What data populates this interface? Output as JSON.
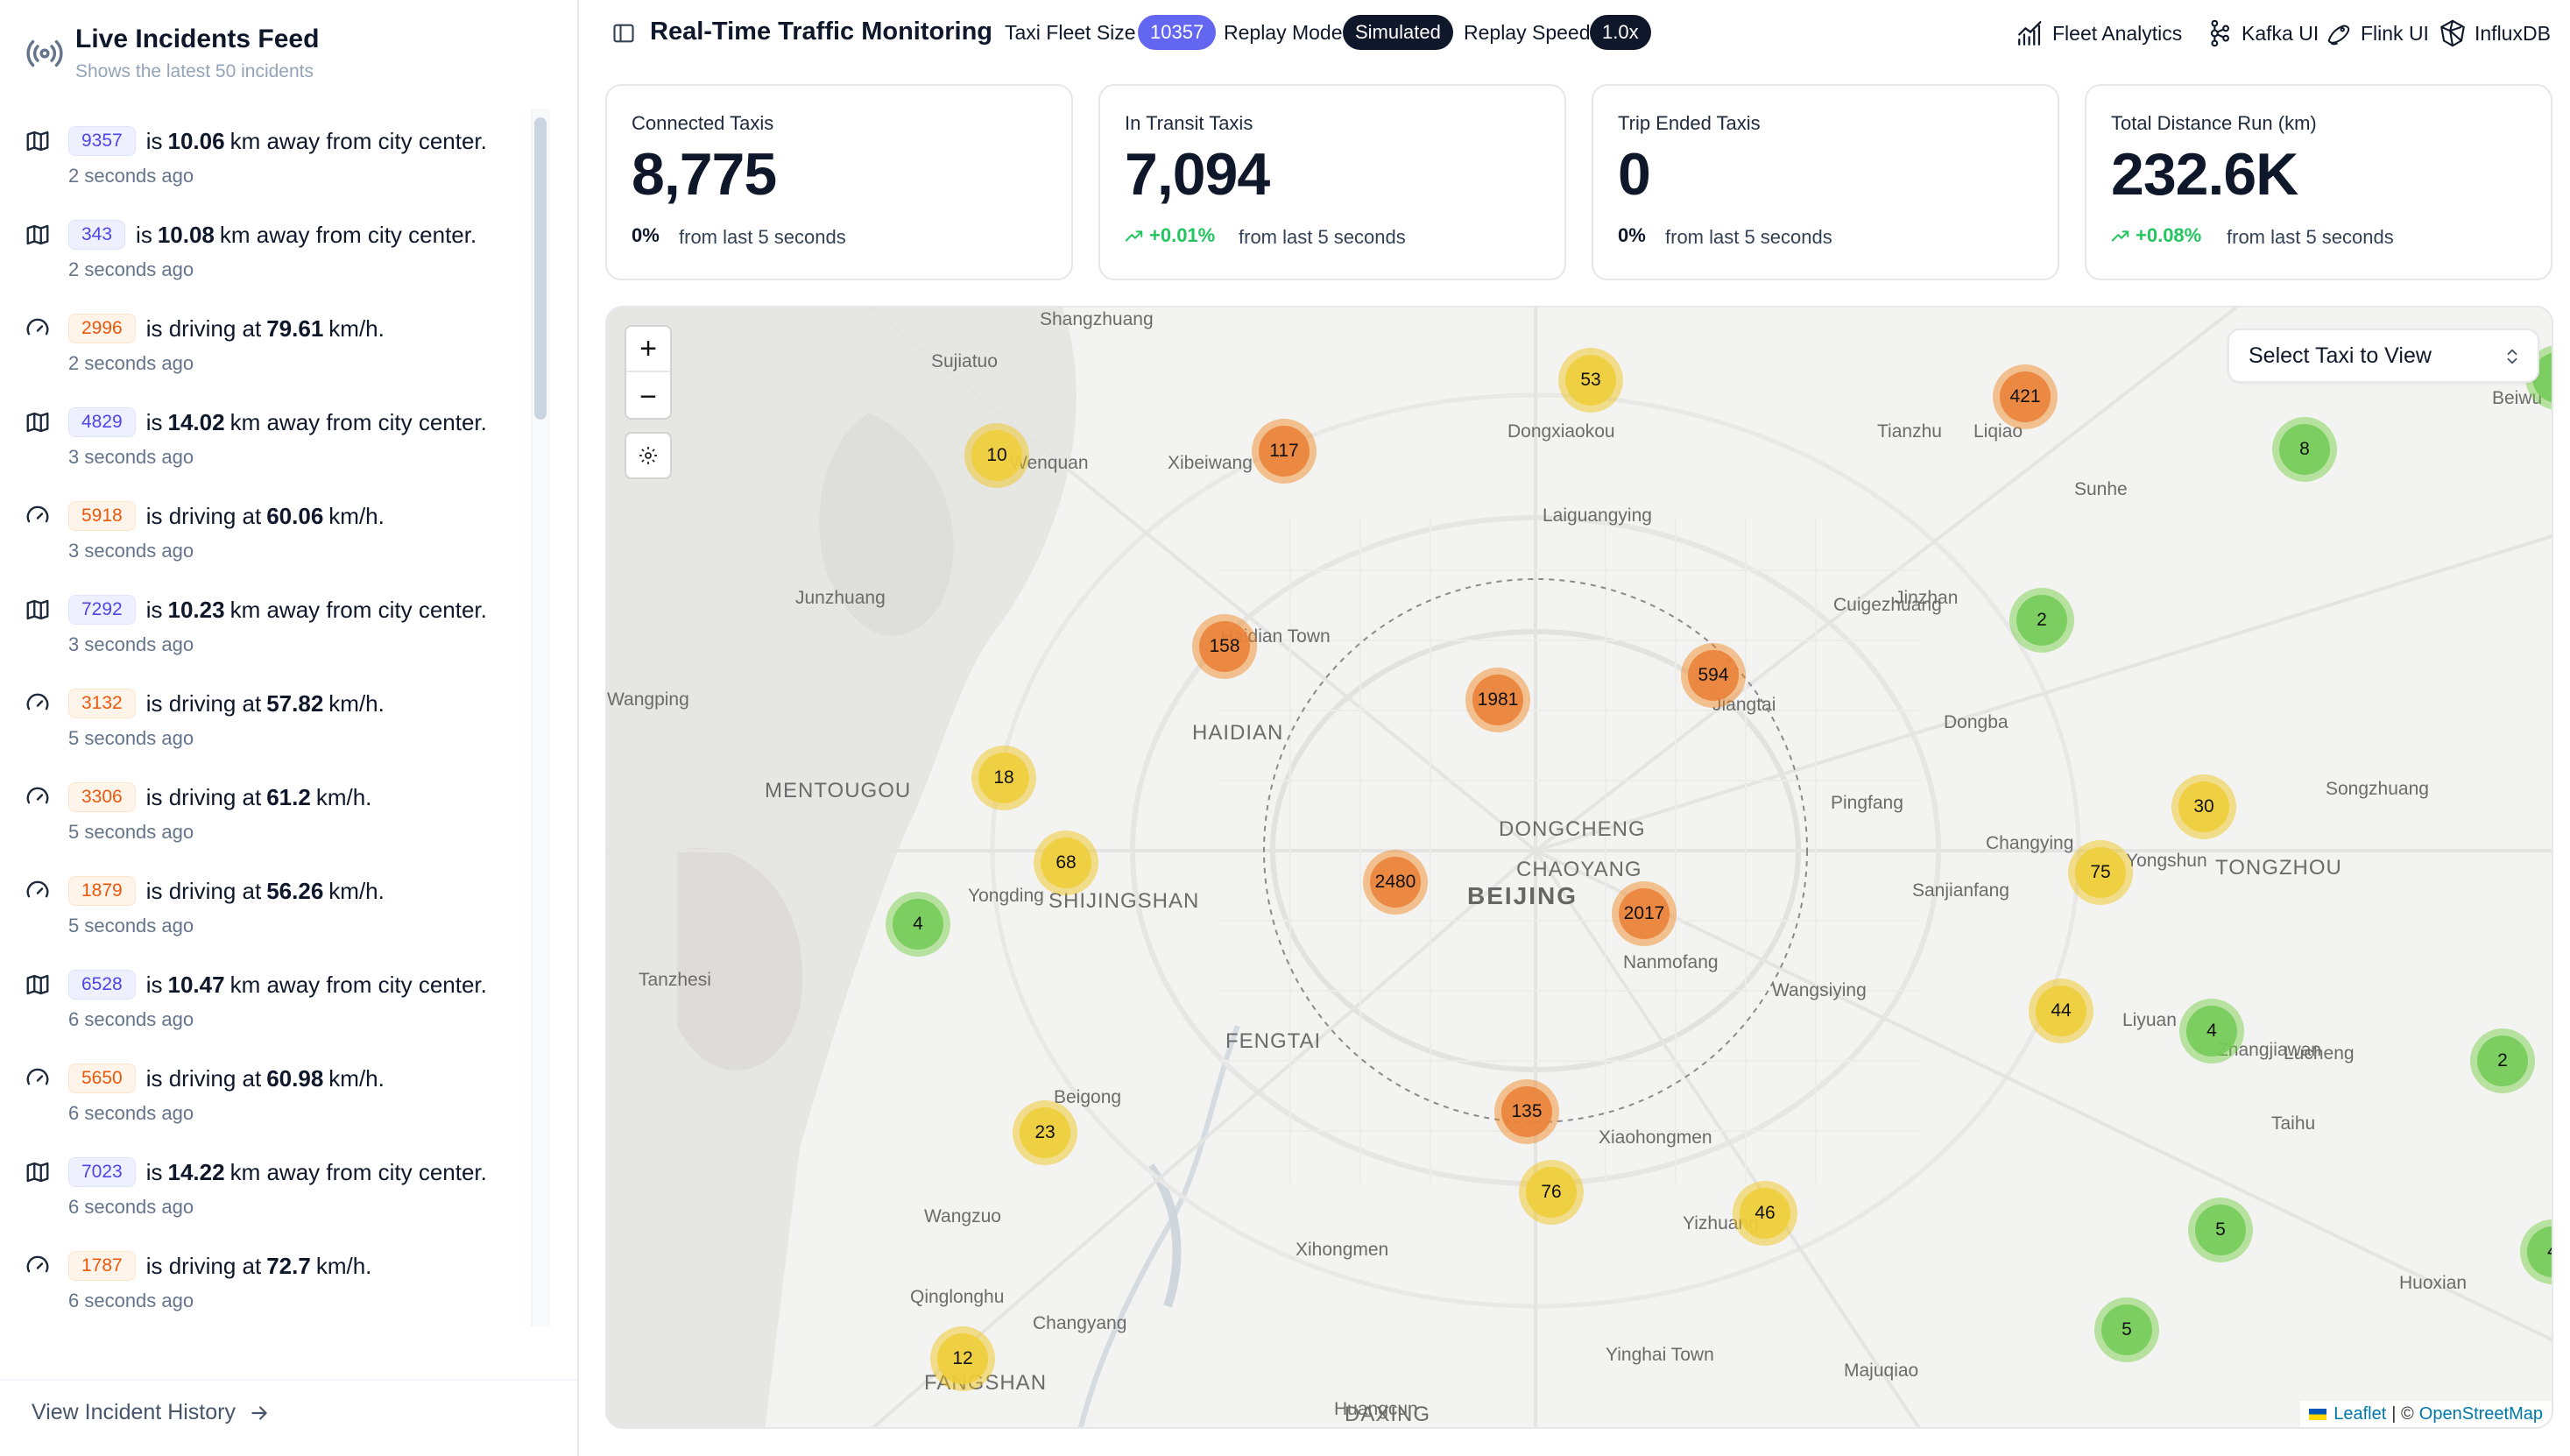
{
  "sidebar": {
    "title": "Live Incidents Feed",
    "subtitle": "Shows the latest 50 incidents",
    "history_link": "View Incident History",
    "incidents": [
      {
        "type": "distance",
        "icon": "map-icon",
        "taxi": "9357",
        "pre": "is",
        "value": "10.06",
        "post": "km away from city center.",
        "time": "2 seconds ago"
      },
      {
        "type": "distance",
        "icon": "map-icon",
        "taxi": "343",
        "pre": "is",
        "value": "10.08",
        "post": "km away from city center.",
        "time": "2 seconds ago"
      },
      {
        "type": "speed",
        "icon": "gauge-icon",
        "taxi": "2996",
        "pre": "is driving at",
        "value": "79.61",
        "post": "km/h.",
        "time": "2 seconds ago"
      },
      {
        "type": "distance",
        "icon": "map-icon",
        "taxi": "4829",
        "pre": "is",
        "value": "14.02",
        "post": "km away from city center.",
        "time": "3 seconds ago"
      },
      {
        "type": "speed",
        "icon": "gauge-icon",
        "taxi": "5918",
        "pre": "is driving at",
        "value": "60.06",
        "post": "km/h.",
        "time": "3 seconds ago"
      },
      {
        "type": "distance",
        "icon": "map-icon",
        "taxi": "7292",
        "pre": "is",
        "value": "10.23",
        "post": "km away from city center.",
        "time": "3 seconds ago"
      },
      {
        "type": "speed",
        "icon": "gauge-icon",
        "taxi": "3132",
        "pre": "is driving at",
        "value": "57.82",
        "post": "km/h.",
        "time": "5 seconds ago"
      },
      {
        "type": "speed",
        "icon": "gauge-icon",
        "taxi": "3306",
        "pre": "is driving at",
        "value": "61.2",
        "post": "km/h.",
        "time": "5 seconds ago"
      },
      {
        "type": "speed",
        "icon": "gauge-icon",
        "taxi": "1879",
        "pre": "is driving at",
        "value": "56.26",
        "post": "km/h.",
        "time": "5 seconds ago"
      },
      {
        "type": "distance",
        "icon": "map-icon",
        "taxi": "6528",
        "pre": "is",
        "value": "10.47",
        "post": "km away from city center.",
        "time": "6 seconds ago"
      },
      {
        "type": "speed",
        "icon": "gauge-icon",
        "taxi": "5650",
        "pre": "is driving at",
        "value": "60.98",
        "post": "km/h.",
        "time": "6 seconds ago"
      },
      {
        "type": "distance",
        "icon": "map-icon",
        "taxi": "7023",
        "pre": "is",
        "value": "14.22",
        "post": "km away from city center.",
        "time": "6 seconds ago"
      },
      {
        "type": "speed",
        "icon": "gauge-icon",
        "taxi": "1787",
        "pre": "is driving at",
        "value": "72.7",
        "post": "km/h.",
        "time": "6 seconds ago"
      }
    ]
  },
  "topbar": {
    "title": "Real-Time Traffic Monitoring",
    "fleet_size_label": "Taxi Fleet Size",
    "fleet_size_value": "10357",
    "replay_mode_label": "Replay Mode",
    "replay_mode_value": "Simulated",
    "replay_speed_label": "Replay Speed",
    "replay_speed_value": "1.0x",
    "links": [
      {
        "label": "Fleet Analytics",
        "icon": "chart-icon"
      },
      {
        "label": "Kafka UI",
        "icon": "kafka-icon"
      },
      {
        "label": "Flink UI",
        "icon": "flink-icon"
      },
      {
        "label": "InfluxDB",
        "icon": "influxdb-icon"
      }
    ]
  },
  "stats": [
    {
      "label": "Connected Taxis",
      "value": "8,775",
      "change": "0%",
      "trend": "flat",
      "sub": "from last 5 seconds"
    },
    {
      "label": "In Transit Taxis",
      "value": "7,094",
      "change": "+0.01%",
      "trend": "up",
      "sub": "from last 5 seconds"
    },
    {
      "label": "Trip Ended Taxis",
      "value": "0",
      "change": "0%",
      "trend": "flat",
      "sub": "from last 5 seconds"
    },
    {
      "label": "Total Distance Run (km)",
      "value": "232.6K",
      "change": "+0.08%",
      "trend": "up",
      "sub": "from last 5 seconds"
    }
  ],
  "map": {
    "zoom_in": "+",
    "zoom_out": "−",
    "select_placeholder": "Select Taxi to View",
    "attribution_leaflet": "Leaflet",
    "attribution_sep": "| ©",
    "attribution_osm": "OpenStreetMap",
    "labels": [
      "Shangzhuang",
      "Sujiatuo",
      "Dongxiaokou",
      "Tianzhu",
      "Liqiao",
      "Beiwu",
      "Xibeiwang",
      "Wenquan",
      "Sunhe",
      "Laiguangying",
      "Junzhuang",
      "Haidian Town",
      "Cuigezhuang",
      "Jinzhan",
      "Wangping",
      "HAIDIAN",
      "Jiangtai",
      "Dongba",
      "MENTOUGOU",
      "Pingfang",
      "Songzhuang",
      "DONGCHENG",
      "CHAOYANG",
      "Changying",
      "Yongshun",
      "TONGZHOU",
      "SHIJINGSHAN",
      "BEIJING",
      "Sanjianfang",
      "Yongding",
      "Nanmofang",
      "Tanzhesi",
      "Wangsiying",
      "Liyuan",
      "FENGTAI",
      "Zhangjiawan",
      "Lucheng",
      "Beigong",
      "Taihu",
      "Xiaohongmen",
      "Wangzuo",
      "Yizhuang",
      "Xihongmen",
      "Huoxian",
      "Qinglonghu",
      "Changyang",
      "Yinghai Town",
      "FANGSHAN",
      "Majuqiao",
      "Huangcun",
      "DAXING"
    ],
    "clusters": [
      {
        "count": "10",
        "color": "yellow"
      },
      {
        "count": "117",
        "color": "orange"
      },
      {
        "count": "53",
        "color": "yellow"
      },
      {
        "count": "421",
        "color": "orange"
      },
      {
        "count": "8",
        "color": "green"
      },
      {
        "count": "2",
        "color": "green"
      },
      {
        "count": "158",
        "color": "orange"
      },
      {
        "count": "1981",
        "color": "orange"
      },
      {
        "count": "594",
        "color": "orange"
      },
      {
        "count": "2",
        "color": "green"
      },
      {
        "count": "18",
        "color": "yellow"
      },
      {
        "count": "68",
        "color": "yellow"
      },
      {
        "count": "2480",
        "color": "orange"
      },
      {
        "count": "30",
        "color": "yellow"
      },
      {
        "count": "75",
        "color": "yellow"
      },
      {
        "count": "4",
        "color": "green"
      },
      {
        "count": "2017",
        "color": "orange"
      },
      {
        "count": "44",
        "color": "yellow"
      },
      {
        "count": "4",
        "color": "green"
      },
      {
        "count": "2",
        "color": "green"
      },
      {
        "count": "23",
        "color": "yellow"
      },
      {
        "count": "135",
        "color": "orange"
      },
      {
        "count": "76",
        "color": "yellow"
      },
      {
        "count": "46",
        "color": "yellow"
      },
      {
        "count": "5",
        "color": "green"
      },
      {
        "count": "4",
        "color": "green"
      },
      {
        "count": "5",
        "color": "green"
      },
      {
        "count": "12",
        "color": "yellow"
      }
    ]
  }
}
